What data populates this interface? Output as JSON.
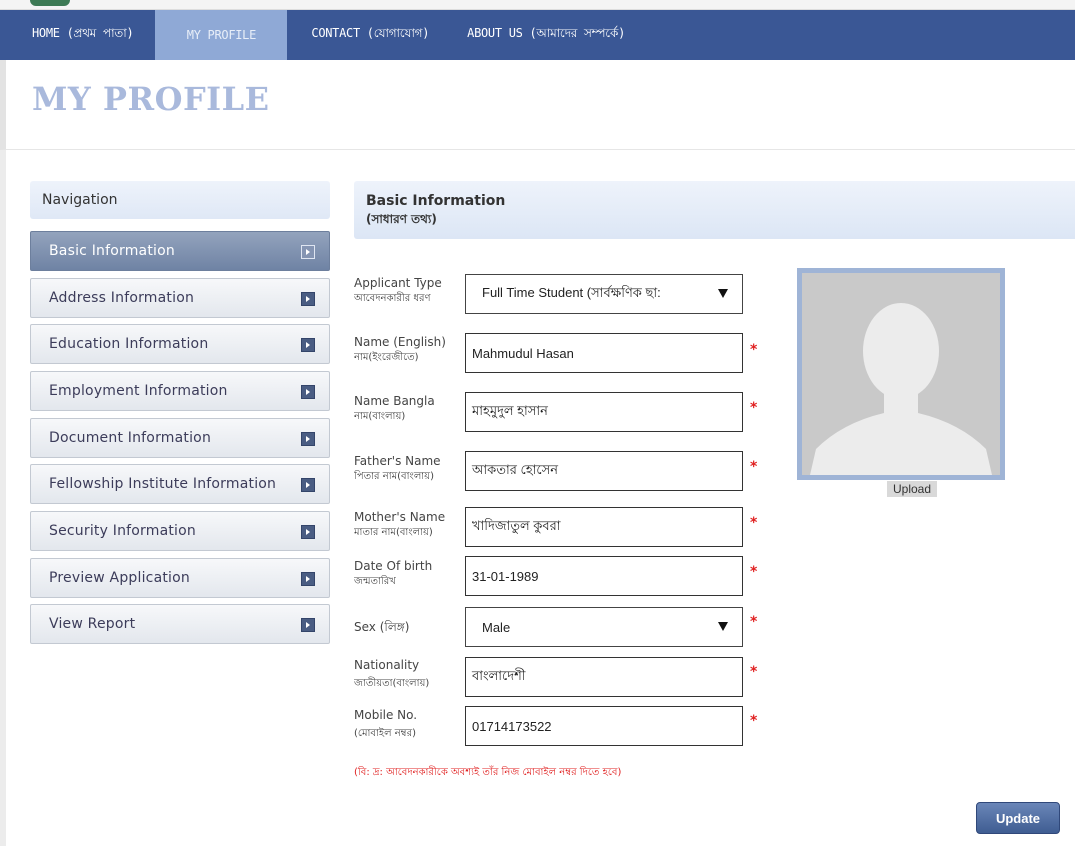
{
  "nav": {
    "home": "HOME (প্রথম পাতা)",
    "profile": "MY PROFILE",
    "contact": "CONTACT (যোগাযোগ)",
    "about": "ABOUT US (আমাদের সম্পর্কে)"
  },
  "page": {
    "title": "MY PROFILE"
  },
  "sidebar": {
    "heading": "Navigation",
    "items": [
      {
        "label": "Basic Information",
        "active": true
      },
      {
        "label": "Address Information"
      },
      {
        "label": "Education Information"
      },
      {
        "label": "Employment Information"
      },
      {
        "label": "Document Information"
      },
      {
        "label": "Fellowship Institute Information"
      },
      {
        "label": "Security Information"
      },
      {
        "label": "Preview Application"
      },
      {
        "label": "View Report"
      }
    ]
  },
  "section": {
    "title": "Basic Information",
    "subtitle": "(সাধারণ তথ্য)"
  },
  "form": {
    "applicant_type": {
      "label": "Applicant Type",
      "label_bn": "আবেদনকারীর ধরণ",
      "value": "Full Time Student (সার্বক্ষণিক ছা:"
    },
    "name_en": {
      "label": "Name (English)",
      "label_bn": "নাম(ইংরেজীতে)",
      "value": "Mahmudul  Hasan"
    },
    "name_bn": {
      "label": "Name Bangla",
      "label_bn": "নাম(বাংলায়)",
      "value": "মাহমুদুল হাসান"
    },
    "father": {
      "label": "Father's Name",
      "label_bn": "পিতার নাম(বাংলায়)",
      "value": "আকতার হোসেন"
    },
    "mother": {
      "label": "Mother's Name",
      "label_bn": "মাতার নাম(বাংলায়)",
      "value": "খাদিজাতুল কুবরা"
    },
    "dob": {
      "label": "Date Of birth",
      "label_bn": "জন্মতারিখ",
      "value": "31-01-1989"
    },
    "sex": {
      "label": "Sex (লিঙ্গ)",
      "value": "Male"
    },
    "nationality": {
      "label": "Nationality",
      "label_bn": "জাতীয়তা(বাংলায়)",
      "value": "বাংলাদেশী"
    },
    "mobile": {
      "label": "Mobile No.",
      "label_bn": "(মোবাইল নম্বর)",
      "value": "01714173522"
    },
    "required_mark": "*",
    "note": "(বি: দ্র: আবেদনকারীকে অবশ্যই তাঁর নিজ মোবাইল নম্বর দিতে হবে)"
  },
  "photo": {
    "upload_label": "Upload"
  },
  "actions": {
    "update": "Update"
  },
  "colors": {
    "navbar": "#3a5795",
    "active_tab": "#8fa9d6",
    "title": "#a9b9dc",
    "required": "#e02020"
  }
}
